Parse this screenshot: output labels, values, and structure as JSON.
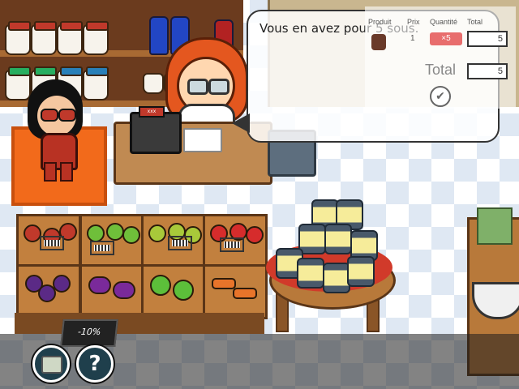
{
  "dialogue": {
    "text": "Vous en avez pour 5 sous."
  },
  "receipt": {
    "headers": [
      "Produit",
      "Prix",
      "Quantité",
      "Total"
    ],
    "row": {
      "price": "1",
      "quantity": "×5",
      "total": "5"
    },
    "total_label": "Total",
    "total_value": "5"
  },
  "register_display": "xxx",
  "discount": {
    "label": "-10%"
  },
  "controls": {
    "money_icon": "coins-icon",
    "help_label": "?"
  },
  "colors": {
    "dialog_bg": "#ffffff",
    "qty_badge": "#e86d6d",
    "rug": "#f26a1b",
    "help_button": "#1f3f4c"
  }
}
